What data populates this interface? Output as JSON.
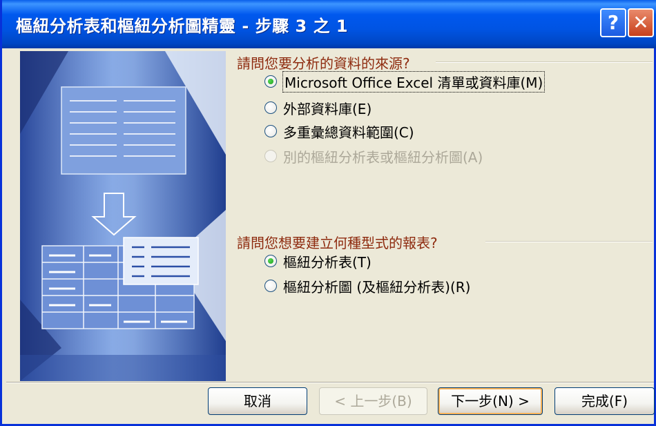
{
  "window": {
    "title": "樞紐分析表和樞紐分析圖精靈 - 步驟 3 之 1",
    "help_glyph": "?",
    "close_glyph": "✕"
  },
  "source_group": {
    "label": "請問您要分析的資料的來源?",
    "options": [
      {
        "label": "Microsoft Office Excel 清單或資料庫(M)",
        "selected": true,
        "enabled": true
      },
      {
        "label": "外部資料庫(E)",
        "selected": false,
        "enabled": true
      },
      {
        "label": "多重彙總資料範圍(C)",
        "selected": false,
        "enabled": true
      },
      {
        "label": "別的樞紐分析表或樞紐分析圖(A)",
        "selected": false,
        "enabled": false
      }
    ]
  },
  "report_group": {
    "label": "請問您想要建立何種型式的報表?",
    "options": [
      {
        "label": "樞紐分析表(T)",
        "selected": true,
        "enabled": true
      },
      {
        "label": "樞紐分析圖 (及樞紐分析表)(R)",
        "selected": false,
        "enabled": true
      }
    ]
  },
  "buttons": {
    "cancel": "取消",
    "back": "< 上一步(B)",
    "next": "下一步(N) >",
    "finish": "完成(F)"
  },
  "colors": {
    "titlebar": "#0054E3",
    "dialog_bg": "#ECE9D8",
    "group_label": "#8E2B0F",
    "radio_selected": "#21A121"
  }
}
